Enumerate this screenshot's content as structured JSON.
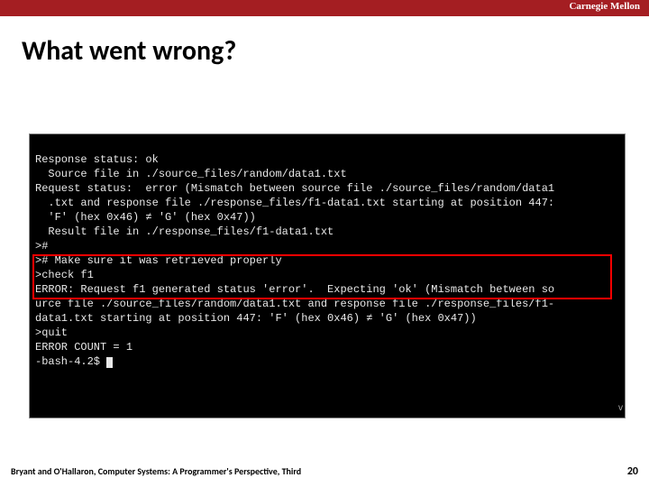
{
  "header": {
    "institution": "Carnegie Mellon"
  },
  "slide": {
    "title": "What went wrong?"
  },
  "terminal": {
    "lines": [
      "Response status: ok",
      "  Source file in ./source_files/random/data1.txt",
      "Request status:  error (Mismatch between source file ./source_files/random/data1",
      "  .txt and response file ./response_files/f1-data1.txt starting at position 447:",
      "  'F' (hex 0x46) ≠ 'G' (hex 0x47))",
      "  Result file in ./response_files/f1-data1.txt",
      ">#",
      "># Make sure it was retrieved properly",
      ">check f1",
      "ERROR: Request f1 generated status 'error'.  Expecting 'ok' (Mismatch between so",
      "urce file ./source_files/random/data1.txt and response file ./response_files/f1-",
      "data1.txt starting at position 447: 'F' (hex 0x46) ≠ 'G' (hex 0x47))",
      ">quit",
      "ERROR COUNT = 1",
      "-bash-4.2$ "
    ]
  },
  "footer": {
    "citation": "Bryant and O'Hallaron, Computer Systems: A Programmer's Perspective, Third",
    "page": "20"
  }
}
